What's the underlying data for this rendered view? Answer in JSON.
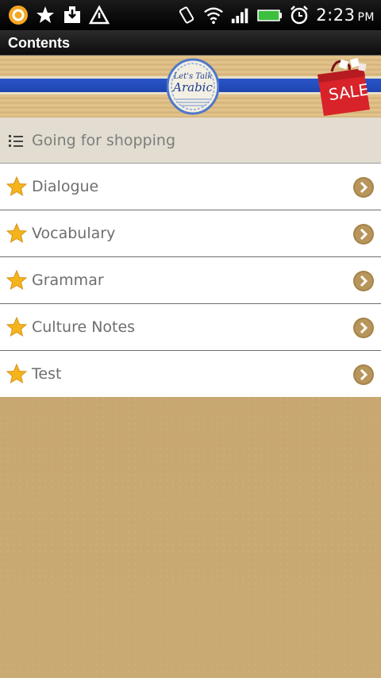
{
  "status_bar": {
    "icons_left": [
      "target-icon",
      "star-icon",
      "download-icon",
      "warning-icon"
    ],
    "icons_right": [
      "vibrate-icon",
      "wifi-icon",
      "signal-icon",
      "battery-icon",
      "alarm-icon"
    ],
    "time": "2:23",
    "ampm": "PM"
  },
  "title_bar": {
    "title": "Contents"
  },
  "banner": {
    "logo_line1": "Let's Talk",
    "logo_line2": "Arabic",
    "sale_text": "SALE"
  },
  "section": {
    "label": "Going for shopping",
    "icon": "list-icon"
  },
  "menu": {
    "items": [
      {
        "label": "Dialogue"
      },
      {
        "label": "Vocabulary"
      },
      {
        "label": "Grammar"
      },
      {
        "label": "Culture Notes"
      },
      {
        "label": "Test"
      }
    ]
  },
  "colors": {
    "banner_blue": "#2a55c9",
    "star": "#f5b41c",
    "chevron": "#a5844a",
    "background": "#c9ab72"
  }
}
